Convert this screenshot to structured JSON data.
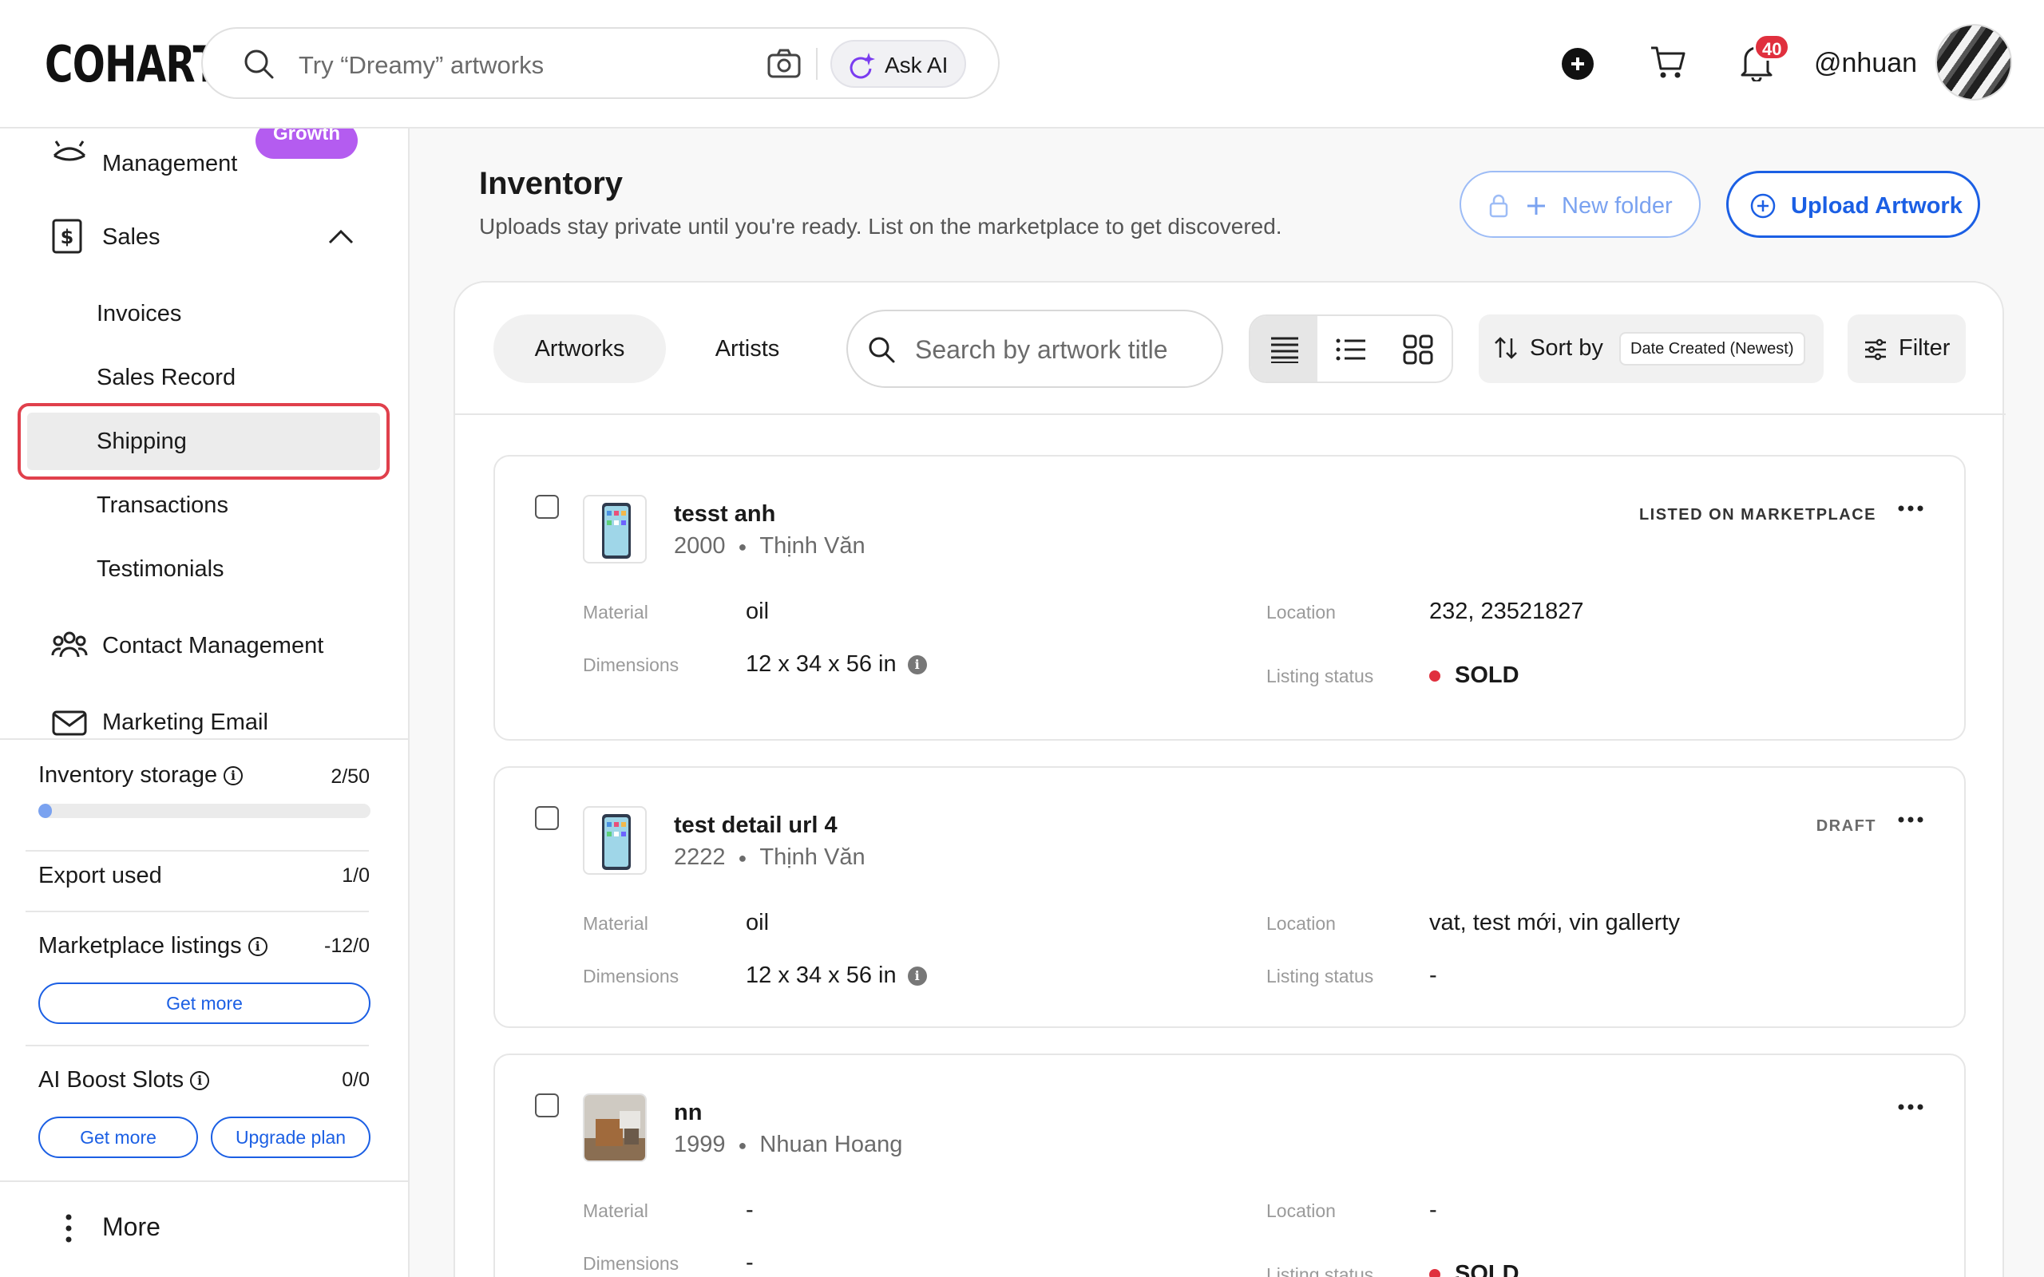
{
  "header": {
    "logo": "COHART",
    "search_placeholder": "Try “Dreamy” artworks",
    "ask_ai_label": "Ask AI",
    "notifications_count": "40",
    "username": "@nhuan"
  },
  "sidebar": {
    "management_label": "Management",
    "growth_badge": "Growth",
    "sales_label": "Sales",
    "sales_items": [
      "Invoices",
      "Sales Record",
      "Shipping",
      "Transactions",
      "Testimonials"
    ],
    "contact_label": "Contact Management",
    "marketing_label": "Marketing Email",
    "inventory_storage": {
      "label": "Inventory storage",
      "value": "2/50",
      "progress_fraction": 0.04
    },
    "export_used": {
      "label": "Export used",
      "value": "1/0"
    },
    "marketplace_listings": {
      "label": "Marketplace listings",
      "value": "-12/0",
      "button": "Get more"
    },
    "ai_boost": {
      "label": "AI Boost Slots",
      "value": "0/0",
      "button_more": "Get more",
      "button_upgrade": "Upgrade plan"
    },
    "more_label": "More"
  },
  "main": {
    "title": "Inventory",
    "subtitle": "Uploads stay private until you're ready. List on the marketplace to get discovered.",
    "new_folder_label": "New folder",
    "upload_label": "Upload Artwork",
    "tabs": [
      "Artworks",
      "Artists"
    ],
    "search_placeholder": "Search by artwork title",
    "sort_label": "Sort by",
    "sort_value": "Date Created (Newest)",
    "filter_label": "Filter",
    "field_labels": {
      "material": "Material",
      "dimensions": "Dimensions",
      "location": "Location",
      "listing_status": "Listing status"
    },
    "artworks": [
      {
        "title": "tesst anh",
        "year": "2000",
        "artist": "Thịnh Văn",
        "status": "LISTED ON MARKETPLACE",
        "material": "oil",
        "dimensions": "12 x 34 x 56 in",
        "location": "232, 23521827",
        "listing_status": "SOLD"
      },
      {
        "title": "test detail url 4",
        "year": "2222",
        "artist": "Thịnh Văn",
        "status": "DRAFT",
        "material": "oil",
        "dimensions": "12 x 34 x 56 in",
        "location": "vat, test mới, vin gallerty",
        "listing_status": "-"
      },
      {
        "title": "nn",
        "year": "1999",
        "artist": "Nhuan Hoang",
        "status": "",
        "material": "-",
        "dimensions": "-",
        "location": "-",
        "listing_status": "SOLD"
      }
    ]
  },
  "colors": {
    "accent": "#1b5fe4",
    "highlight": "#e0404c",
    "sold": "#e0303e",
    "growth": "#b45cf0"
  }
}
